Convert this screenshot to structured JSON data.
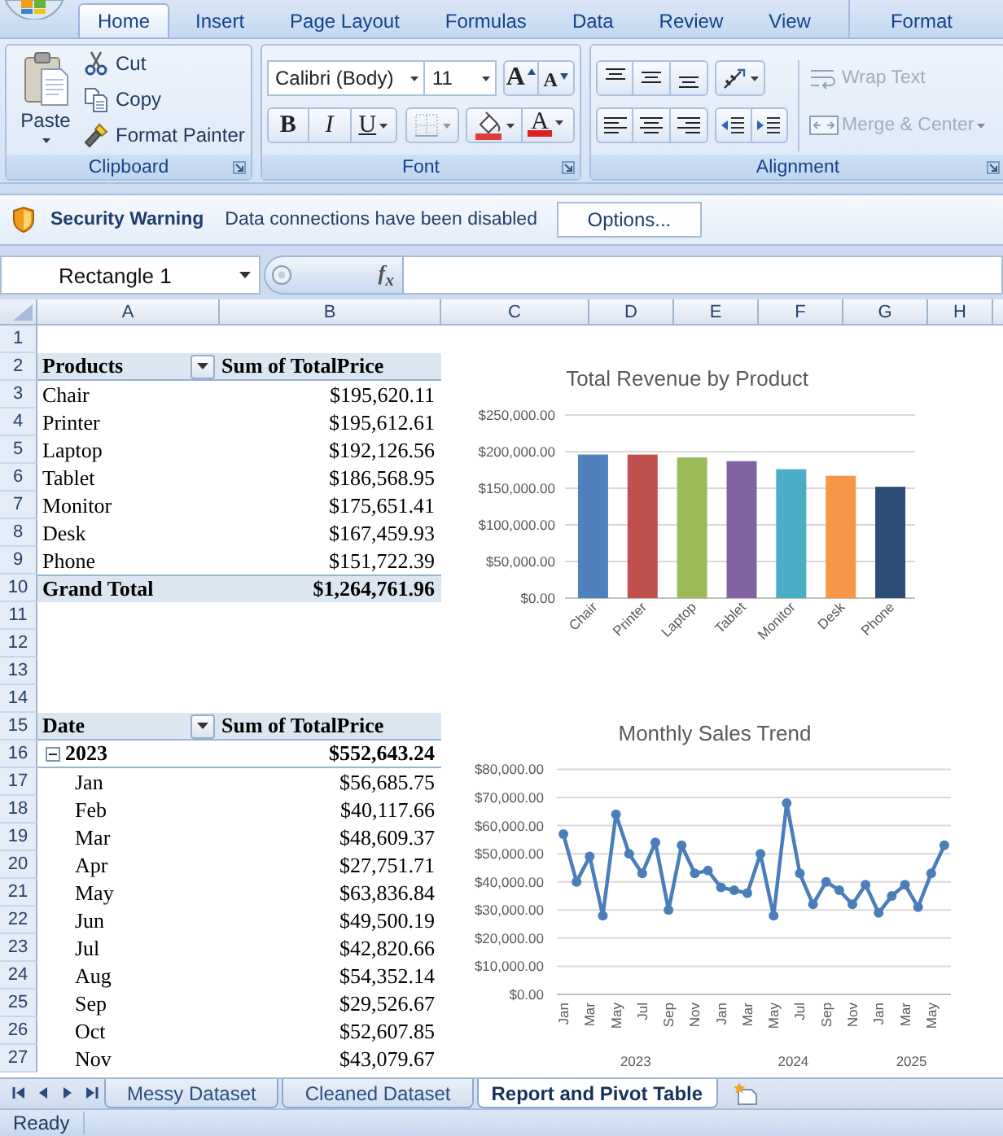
{
  "ribbon": {
    "tabs": [
      {
        "label": "Home",
        "selected": true,
        "kind": "standard"
      },
      {
        "label": "Insert",
        "selected": false,
        "kind": "standard"
      },
      {
        "label": "Page Layout",
        "selected": false,
        "kind": "standard"
      },
      {
        "label": "Formulas",
        "selected": false,
        "kind": "standard"
      },
      {
        "label": "Data",
        "selected": false,
        "kind": "standard"
      },
      {
        "label": "Review",
        "selected": false,
        "kind": "standard"
      },
      {
        "label": "View",
        "selected": false,
        "kind": "standard"
      },
      {
        "label": "Format",
        "selected": false,
        "kind": "contextual"
      }
    ],
    "clipboard": {
      "label": "Clipboard",
      "paste": "Paste",
      "commands": [
        {
          "kind": "cut",
          "label": "Cut"
        },
        {
          "kind": "copy",
          "label": "Copy"
        },
        {
          "kind": "format_painter",
          "label": "Format Painter"
        }
      ]
    },
    "font": {
      "label": "Font",
      "font_name": "Calibri (Body)",
      "font_size": "11",
      "size_buttons": [
        {
          "kind": "grow",
          "label": "A"
        },
        {
          "kind": "shrink",
          "label": "A"
        }
      ],
      "format_buttons": [
        {
          "kind": "bold",
          "label": "B",
          "disabled": false
        },
        {
          "kind": "italic",
          "label": "I",
          "disabled": false
        },
        {
          "kind": "underline",
          "label": "U",
          "disabled": false
        },
        {
          "kind": "borders",
          "disabled": true
        },
        {
          "kind": "fill_color",
          "disabled": false,
          "color": "#e03c3c"
        },
        {
          "kind": "font_color",
          "label": "A",
          "disabled": false,
          "color": "#e02020"
        }
      ]
    },
    "alignment": {
      "label": "Alignment",
      "buttons": [
        {
          "kind": "top"
        },
        {
          "kind": "middle"
        },
        {
          "kind": "bottom"
        },
        {
          "kind": "orientation"
        },
        {
          "kind": "left"
        },
        {
          "kind": "center"
        },
        {
          "kind": "right"
        },
        {
          "kind": "decrease_indent"
        },
        {
          "kind": "increase_indent"
        }
      ],
      "commands": [
        {
          "kind": "wrap_text",
          "label": "Wrap Text",
          "disabled": true
        },
        {
          "kind": "merge_center",
          "label": "Merge & Center",
          "disabled": true
        }
      ]
    }
  },
  "security_bar": {
    "title": "Security Warning",
    "message": "Data connections have been disabled",
    "button": "Options..."
  },
  "formula_bar": {
    "name_box": "Rectangle 1",
    "function_button": "f$_{x}$"
  },
  "sheet": {
    "columns": [
      "A",
      "B",
      "C",
      "D",
      "E",
      "F",
      "G",
      "H"
    ],
    "row_numbers": [
      "1",
      "2",
      "3",
      "4",
      "5",
      "6",
      "7",
      "8",
      "9",
      "10",
      "11",
      "12",
      "13",
      "14",
      "15",
      "16",
      "17",
      "18",
      "19",
      "20",
      "21",
      "22",
      "23",
      "24",
      "25",
      "26",
      "27"
    ],
    "pivot_tables": [
      {
        "headers": [
          "Products",
          "Sum of TotalPrice"
        ],
        "items": [
          {
            "label": "Chair",
            "value": "$195,620.11"
          },
          {
            "label": "Printer",
            "value": "$195,612.61"
          },
          {
            "label": "Laptop",
            "value": "$192,126.56"
          },
          {
            "label": "Tablet",
            "value": "$186,568.95"
          },
          {
            "label": "Monitor",
            "value": "$175,651.41"
          },
          {
            "label": "Desk",
            "value": "$167,459.93"
          },
          {
            "label": "Phone",
            "value": "$151,722.39"
          }
        ],
        "total": {
          "label": "Grand Total",
          "value": "$1,264,761.96"
        }
      },
      {
        "headers": [
          "Date",
          "Sum of TotalPrice"
        ],
        "items": [
          {
            "label": "2023",
            "value": "$552,643.24",
            "expanded": true,
            "children": [
              {
                "label": "Jan",
                "value": "$56,685.75"
              },
              {
                "label": "Feb",
                "value": "$40,117.66"
              },
              {
                "label": "Mar",
                "value": "$48,609.37"
              },
              {
                "label": "Apr",
                "value": "$27,751.71"
              },
              {
                "label": "May",
                "value": "$63,836.84"
              },
              {
                "label": "Jun",
                "value": "$49,500.19"
              },
              {
                "label": "Jul",
                "value": "$42,820.66"
              },
              {
                "label": "Aug",
                "value": "$54,352.14"
              },
              {
                "label": "Sep",
                "value": "$29,526.67"
              },
              {
                "label": "Oct",
                "value": "$52,607.85"
              },
              {
                "label": "Nov",
                "value": "$43,079.67"
              }
            ]
          }
        ]
      }
    ],
    "charts": [
      {
        "chart_data": {
          "type": "bar",
          "title": "Total Revenue by Product",
          "categories": [
            "Chair",
            "Printer",
            "Laptop",
            "Tablet",
            "Monitor",
            "Desk",
            "Phone"
          ],
          "values": [
            196000,
            196000,
            192000,
            187000,
            176000,
            167000,
            152000
          ],
          "ylim": [
            0,
            250000
          ],
          "grid": true,
          "yticks": [
            {
              "value": 0,
              "label": "$0.00"
            },
            {
              "value": 50000,
              "label": "$50,000.00"
            },
            {
              "value": 100000,
              "label": "$100,000.00"
            },
            {
              "value": 150000,
              "label": "$150,000.00"
            },
            {
              "value": 200000,
              "label": "$200,000.00"
            },
            {
              "value": 250000,
              "label": "$250,000.00"
            }
          ]
        }
      },
      {
        "chart_data": {
          "type": "line",
          "title": "Monthly Sales Trend",
          "categories": [
            "Jan",
            null,
            "Mar",
            null,
            "May",
            null,
            "Jul",
            null,
            "Sep",
            null,
            "Nov",
            null,
            "Jan",
            null,
            "Mar",
            null,
            "May",
            null,
            "Jul",
            null,
            "Sep",
            null,
            "Nov",
            null,
            "Jan",
            null,
            "Mar",
            null,
            "May",
            null
          ],
          "series": [
            {
              "color": "#4a7ebb",
              "marker": "circle",
              "values": [
                57000,
                40000,
                49000,
                28000,
                64000,
                50000,
                43000,
                54000,
                30000,
                53000,
                43000,
                44000,
                38000,
                37000,
                36000,
                50000,
                28000,
                68000,
                43000,
                32000,
                40000,
                37000,
                32000,
                39000,
                29000,
                35000,
                39000,
                31000,
                43000,
                53000
              ]
            }
          ],
          "ylim": [
            0,
            80000
          ],
          "grid": true,
          "yticks": [
            {
              "value": 0,
              "label": "$0.00"
            },
            {
              "value": 10000,
              "label": "$10,000.00"
            },
            {
              "value": 20000,
              "label": "$20,000.00"
            },
            {
              "value": 30000,
              "label": "$30,000.00"
            },
            {
              "value": 40000,
              "label": "$40,000.00"
            },
            {
              "value": 50000,
              "label": "$50,000.00"
            },
            {
              "value": 60000,
              "label": "$60,000.00"
            },
            {
              "value": 70000,
              "label": "$70,000.00"
            },
            {
              "value": 80000,
              "label": "$80,000.00"
            }
          ],
          "annotations": [
            "2023",
            "2024",
            "2025"
          ]
        }
      }
    ]
  },
  "sheet_tabs": [
    {
      "label": "Messy Dataset",
      "selected": false
    },
    {
      "label": "Cleaned Dataset",
      "selected": false
    },
    {
      "label": "Report and Pivot Table",
      "selected": true
    }
  ],
  "status_bar": {
    "text": "Ready"
  }
}
